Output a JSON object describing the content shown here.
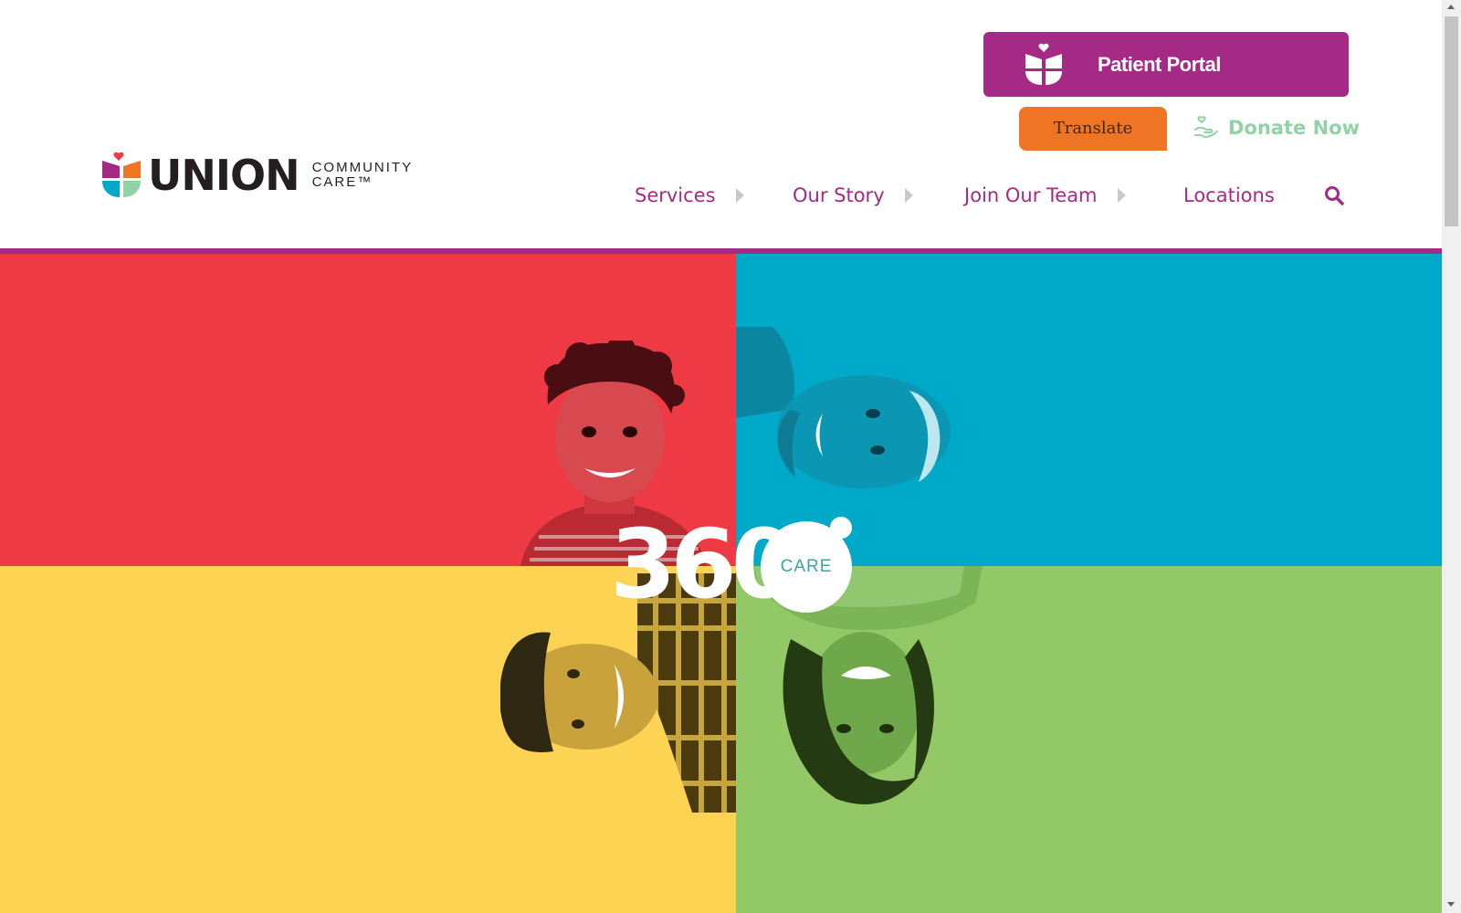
{
  "brand": {
    "name": "UNION",
    "sub_line1": "COMMUNITY",
    "sub_line2": "CARE™",
    "colors": {
      "purple": "#a52a86",
      "orange": "#ef7423",
      "mint": "#93d1a7",
      "teal": "#00a9c8",
      "red": "#ee3a44",
      "yellow": "#fcd352",
      "green": "#92c966"
    }
  },
  "header": {
    "patient_portal": {
      "label": "Patient Portal",
      "icon": "tulip-icon"
    },
    "translate": {
      "label": "Translate"
    },
    "donate": {
      "label": "Donate Now",
      "icon": "giving-hand-icon"
    }
  },
  "nav": {
    "items": [
      {
        "label": "Services",
        "has_submenu": true
      },
      {
        "label": "Our Story",
        "has_submenu": true
      },
      {
        "label": "Join Our Team",
        "has_submenu": true
      },
      {
        "label": "Locations",
        "has_submenu": false
      }
    ],
    "search_icon": "search-icon"
  },
  "hero": {
    "badge_number": "360",
    "badge_label": "CARE",
    "photos": [
      "child-portrait",
      "older-man-portrait",
      "young-man-portrait",
      "woman-portrait"
    ]
  }
}
